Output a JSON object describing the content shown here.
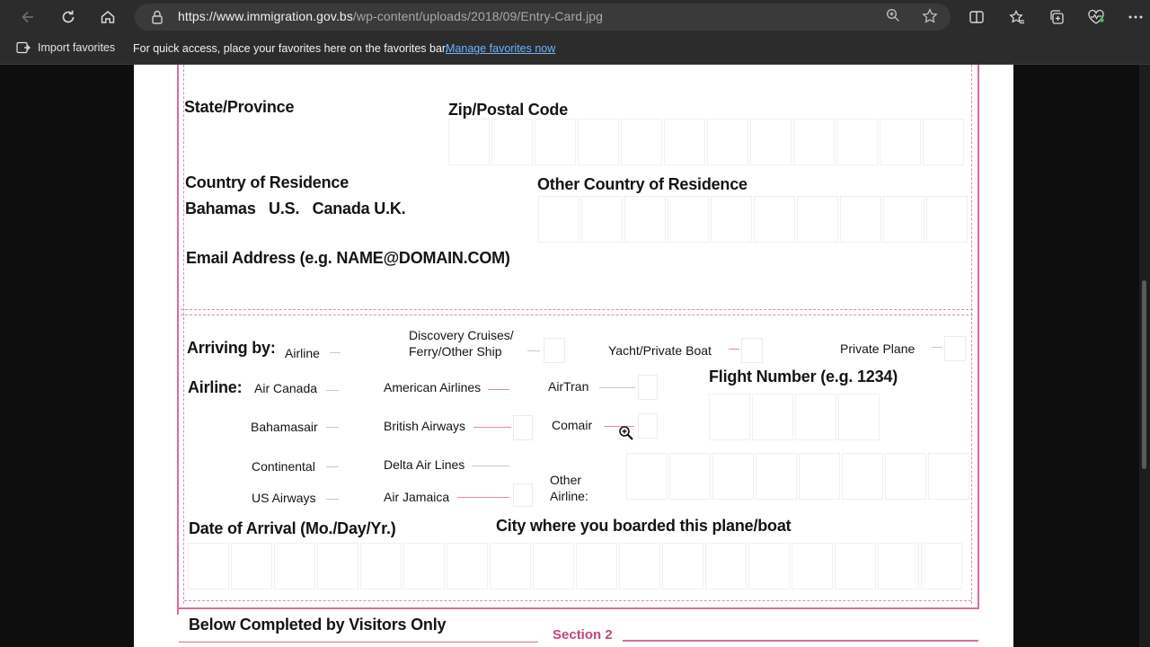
{
  "browser": {
    "url_host": "https://www.immigration.gov.bs",
    "url_path": "/wp-content/uploads/2018/09/Entry-Card.jpg",
    "favorites_import": "Import favorites",
    "favorites_msg": "For quick access, place your favorites here on the favorites bar.",
    "favorites_link": "Manage favorites now",
    "icons": [
      "back-icon",
      "refresh-icon",
      "home-icon",
      "lock-icon",
      "zoom-icon",
      "star-icon",
      "split-screen-icon",
      "favorites-icon",
      "collections-icon",
      "health-icon",
      "more-icon"
    ]
  },
  "form": {
    "state_label": "State/Province",
    "zip_label": "Zip/Postal Code",
    "country_label": "Country of Residence",
    "country_options": "Bahamas   U.S.   Canada U.K.",
    "other_country_label": "Other Country of Residence",
    "email_label": "Email Address (e.g. NAME@DOMAIN.COM)",
    "arriving_label": "Arriving by:",
    "arriving_airline": "Airline",
    "arriving_cruise_1": "Discovery Cruises/",
    "arriving_cruise_2": "Ferry/Other Ship",
    "arriving_yacht": "Yacht/Private Boat",
    "arriving_plane": "Private Plane",
    "airline_label": "Airline:",
    "airlines": {
      "air_canada": "Air Canada",
      "american": "American Airlines",
      "airtran": "AirTran",
      "bahamasair": "Bahamasair",
      "british": "British Airways",
      "comair": "Comair",
      "continental": "Continental",
      "delta": "Delta Air Lines",
      "other_1": "Other",
      "other_2": "Airline:",
      "us_airways": "US Airways",
      "air_jamaica": "Air Jamaica"
    },
    "flight_label": "Flight Number (e.g. 1234)",
    "date_label": "Date of Arrival (Mo./Day/Yr.)",
    "city_label": "City where you boarded this plane/boat",
    "visitors_label": "Below Completed by Visitors Only",
    "section_label": "Section 2"
  },
  "colors": {
    "frame": "#d86c9c",
    "link": "#6fb3ff",
    "chrome": "#2c2c2c"
  }
}
